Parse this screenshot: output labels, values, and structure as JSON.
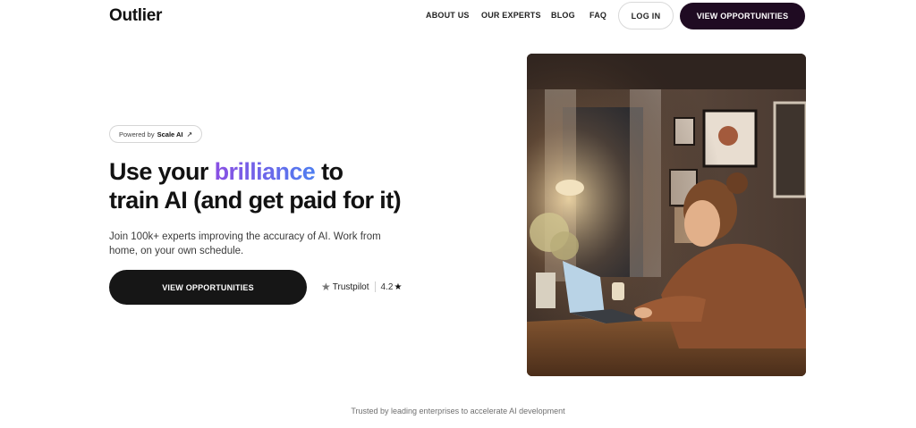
{
  "header": {
    "logo": "Outlier",
    "nav": [
      "ABOUT US",
      "OUR EXPERTS",
      "BLOG",
      "FAQ"
    ],
    "login_label": "LOG IN",
    "cta_label": "VIEW OPPORTUNITIES"
  },
  "hero": {
    "powered_prefix": "Powered by",
    "powered_brand": "Scale AI",
    "powered_icon": "external-arrow-icon",
    "headline_pre": "Use your ",
    "headline_accent": "brilliance",
    "headline_post": " to",
    "headline_line2": "train AI (and get paid for it)",
    "subtext": "Join 100k+ experts improving the accuracy of AI. Work from home, on your own schedule.",
    "cta_label": "VIEW OPPORTUNITIES",
    "trustpilot_label": "Trustpilot",
    "trustpilot_rating": "4.2"
  },
  "footer": {
    "trusted_text": "Trusted by leading enterprises to accelerate AI development"
  },
  "colors": {
    "cta_dark": "#1f0b22",
    "button_dark": "#161616",
    "accent_gradient_start": "#8a4fe3",
    "accent_gradient_end": "#4e7ef0"
  }
}
